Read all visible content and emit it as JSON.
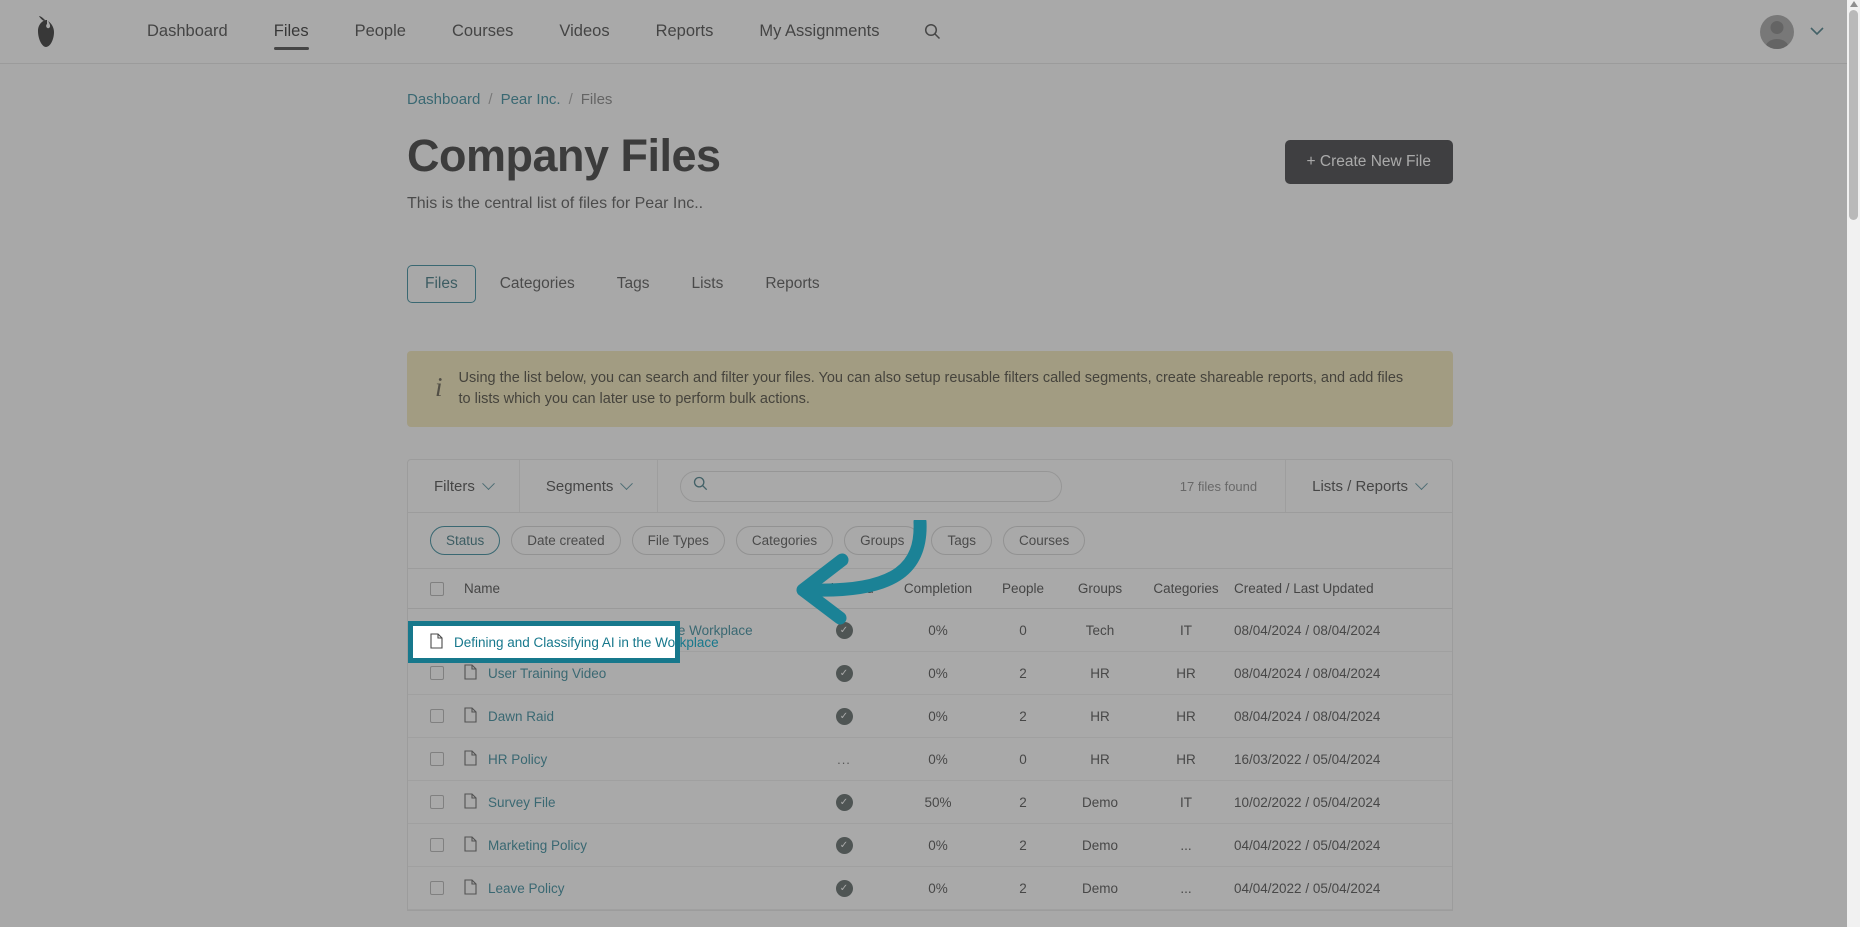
{
  "nav": {
    "logo_icon": "pear-logo-icon",
    "items": [
      {
        "label": "Dashboard",
        "active": false
      },
      {
        "label": "Files",
        "active": true
      },
      {
        "label": "People",
        "active": false
      },
      {
        "label": "Courses",
        "active": false
      },
      {
        "label": "Videos",
        "active": false
      },
      {
        "label": "Reports",
        "active": false
      },
      {
        "label": "My Assignments",
        "active": false
      }
    ],
    "search_icon": "search-icon",
    "avatar_icon": "user-avatar-icon",
    "account_chevron": "chevron-down-icon"
  },
  "breadcrumb": {
    "dashboard": "Dashboard",
    "sep1": "/",
    "company": "Pear Inc.",
    "sep2": "/",
    "current": "Files"
  },
  "header": {
    "title": "Company Files",
    "subtitle": "This is the central list of files for Pear Inc..",
    "create_button": "+ Create New File"
  },
  "tabs": [
    {
      "label": "Files",
      "active": true
    },
    {
      "label": "Categories",
      "active": false
    },
    {
      "label": "Tags",
      "active": false
    },
    {
      "label": "Lists",
      "active": false
    },
    {
      "label": "Reports",
      "active": false
    }
  ],
  "banner": {
    "icon": "info-icon",
    "text": "Using the list below, you can search and filter your files. You can also setup reusable filters called segments, create shareable reports, and add files to lists which you can later use to perform bulk actions."
  },
  "toolbar": {
    "filters_label": "Filters",
    "segments_label": "Segments",
    "search_value": "",
    "search_placeholder": "",
    "search_icon": "search-icon",
    "files_found": "17 files found",
    "lists_reports_label": "Lists / Reports"
  },
  "chips": [
    {
      "label": "Status",
      "active": true
    },
    {
      "label": "Date created",
      "active": false
    },
    {
      "label": "File Types",
      "active": false
    },
    {
      "label": "Categories",
      "active": false
    },
    {
      "label": "Groups",
      "active": false
    },
    {
      "label": "Tags",
      "active": false
    },
    {
      "label": "Courses",
      "active": false
    }
  ],
  "table": {
    "columns": {
      "name": "Name",
      "published": "Published",
      "completion": "Completion",
      "people": "People",
      "groups": "Groups",
      "categories": "Categories",
      "created": "Created / Last Updated"
    },
    "rows": [
      {
        "name": "Defining and Classifying AI in the Workplace",
        "published": "check",
        "completion": "0%",
        "people": "0",
        "groups": "Tech",
        "categories": "IT",
        "created": "08/04/2024 / 08/04/2024"
      },
      {
        "name": "User Training Video",
        "published": "check",
        "completion": "0%",
        "people": "2",
        "groups": "HR",
        "categories": "HR",
        "created": "08/04/2024 / 08/04/2024"
      },
      {
        "name": "Dawn Raid",
        "published": "check",
        "completion": "0%",
        "people": "2",
        "groups": "HR",
        "categories": "HR",
        "created": "08/04/2024 / 08/04/2024"
      },
      {
        "name": "HR Policy",
        "published": "dots",
        "completion": "0%",
        "people": "0",
        "groups": "HR",
        "categories": "HR",
        "created": "16/03/2022 / 05/04/2024"
      },
      {
        "name": "Survey File",
        "published": "check",
        "completion": "50%",
        "people": "2",
        "groups": "Demo",
        "categories": "IT",
        "created": "10/02/2022 / 05/04/2024"
      },
      {
        "name": "Marketing Policy",
        "published": "check",
        "completion": "0%",
        "people": "2",
        "groups": "Demo",
        "categories": "...",
        "created": "04/04/2022 / 05/04/2024"
      },
      {
        "name": "Leave Policy",
        "published": "check",
        "completion": "0%",
        "people": "2",
        "groups": "Demo",
        "categories": "...",
        "created": "04/04/2022 / 05/04/2024"
      }
    ]
  },
  "annotation": {
    "highlight_label": "Defining and Classifying AI in the Workplace",
    "highlight_color": "#17788c",
    "arrow_color": "#1b8296",
    "arrow_icon": "curved-arrow-pointer-icon"
  },
  "colors": {
    "accent": "#17788c",
    "dark_button": "#222326",
    "banner_bg": "#f0e3ae"
  }
}
